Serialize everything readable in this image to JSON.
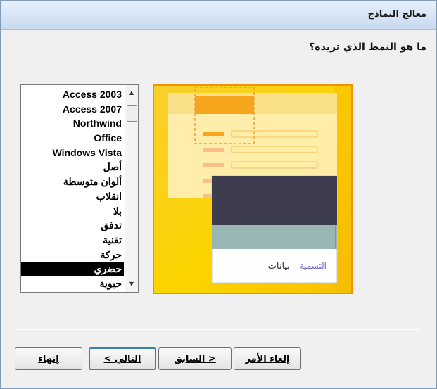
{
  "window": {
    "title": "معالج النماذج"
  },
  "prompt": "ما هو النمط الذي تريده؟",
  "style_list": {
    "items": [
      "Access 2003",
      "Access 2007",
      "Northwind",
      "Office",
      "Windows Vista",
      "أصل",
      "ألوان متوسطة",
      "انقلاب",
      "بلا",
      "تدفق",
      "تقنية",
      "حركة",
      "حضري",
      "حيوية"
    ],
    "selected": "حضري"
  },
  "preview": {
    "caption_label": "التسمية",
    "data_label": "بيانات"
  },
  "buttons": {
    "cancel": "إلغاء الأمر",
    "back": "< السابق",
    "next": "التالي >",
    "finish": "إنهاء"
  },
  "colors": {
    "accent": "#f39200",
    "preview_bg": "#fcd400",
    "selection": "#000000"
  }
}
